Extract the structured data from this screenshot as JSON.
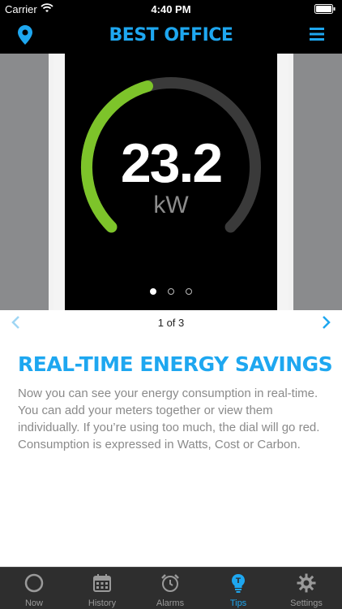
{
  "status": {
    "carrier": "Carrier",
    "time": "4:40 PM"
  },
  "nav": {
    "title": "BEST OFFICE"
  },
  "gauge": {
    "value": "23.2",
    "unit": "kW",
    "fraction": 0.44
  },
  "carousel": {
    "dots": 3,
    "active_dot": 0
  },
  "pager": {
    "label": "1 of 3"
  },
  "tip": {
    "title": "REAL-TIME ENERGY SAVINGS",
    "body": "Now you can see your energy consumption in real-time. You can add your meters together or view them individually. If you’re using too much, the dial will go red. Consumption is expressed in Watts, Cost or Carbon."
  },
  "tabs": [
    {
      "label": "Now",
      "icon": "circle-icon"
    },
    {
      "label": "History",
      "icon": "calendar-icon"
    },
    {
      "label": "Alarms",
      "icon": "alarm-icon"
    },
    {
      "label": "Tips",
      "icon": "bulb-icon"
    },
    {
      "label": "Settings",
      "icon": "gear-icon"
    }
  ],
  "active_tab": 3,
  "colors": {
    "accent": "#1ea7f0",
    "gauge_fill": "#7dc42a",
    "gauge_track": "#3a3a3a"
  }
}
